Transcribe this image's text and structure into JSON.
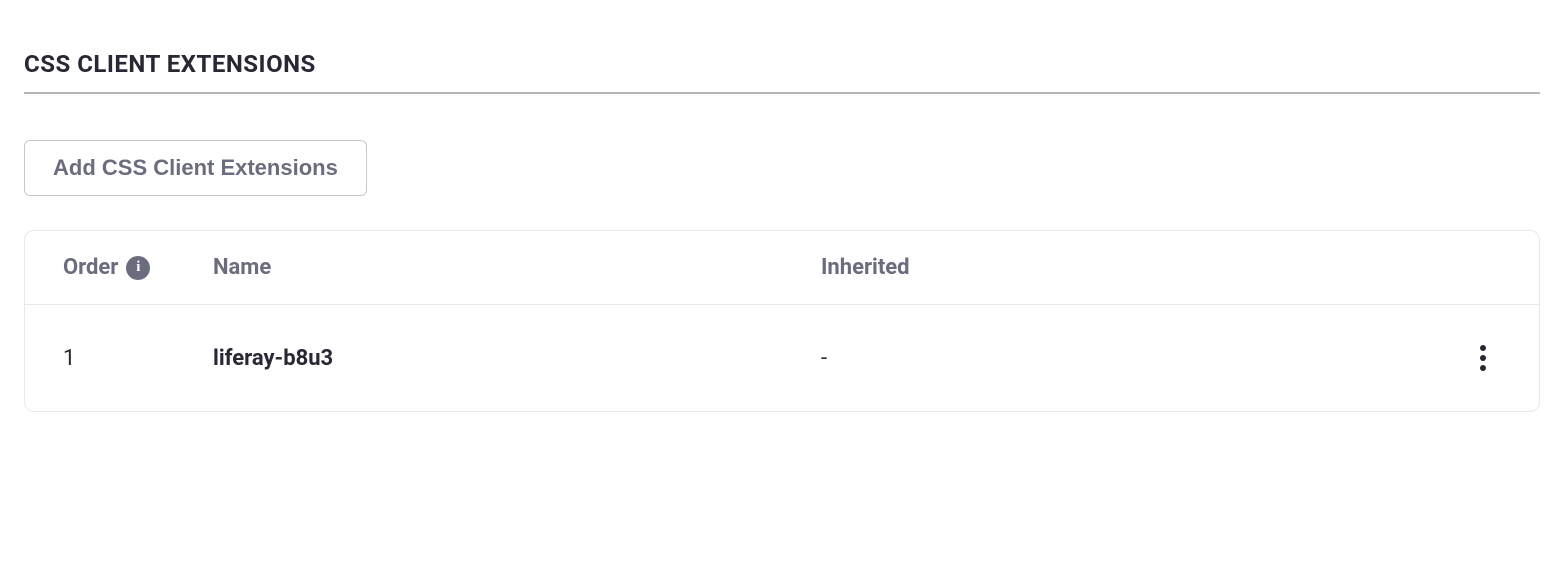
{
  "section": {
    "title": "CSS CLIENT EXTENSIONS",
    "add_button_label": "Add CSS Client Extensions"
  },
  "table": {
    "headers": {
      "order": "Order",
      "name": "Name",
      "inherited": "Inherited"
    },
    "rows": [
      {
        "order": "1",
        "name": "liferay-b8u3",
        "inherited": "-"
      }
    ]
  }
}
